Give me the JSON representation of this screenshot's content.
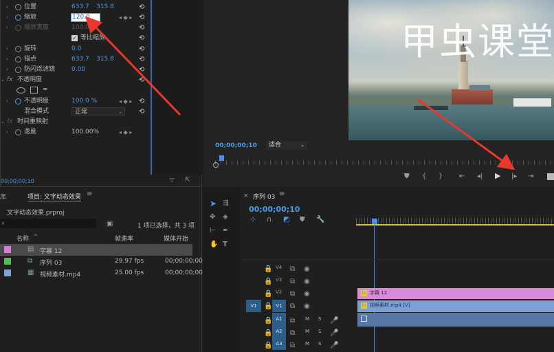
{
  "effect_controls": {
    "rows": [
      {
        "label": "位置",
        "v1": "633.7",
        "v2": "315.8"
      },
      {
        "label": "缩放",
        "v1": "120.0",
        "v2": ""
      },
      {
        "label": "缩放宽度",
        "v1": "100.0",
        "v2": ""
      },
      {
        "label": "等比缩放",
        "v1": "",
        "v2": ""
      },
      {
        "label": "旋转",
        "v1": "0.0",
        "v2": ""
      },
      {
        "label": "锚点",
        "v1": "633.7",
        "v2": "315.8"
      },
      {
        "label": "防闪烁滤镜",
        "v1": "0.00",
        "v2": ""
      },
      {
        "label": "不透明度",
        "v1": "",
        "v2": ""
      },
      {
        "label": "不透明度",
        "v1": "100.0 %",
        "v2": ""
      },
      {
        "label": "混合模式",
        "v1": "正常",
        "v2": ""
      },
      {
        "label": "时间重映射",
        "v1": "",
        "v2": ""
      },
      {
        "label": "速度",
        "v1": "100.00%",
        "v2": ""
      }
    ],
    "fx": "fx",
    "timecode": "00;00;00;10"
  },
  "program_monitor": {
    "overlay_text": "甲虫课堂",
    "timecode": "00;00;00;10",
    "fit_select": "适合",
    "controls": [
      "marker-icon",
      "in-point-icon",
      "out-point-icon",
      "go-to-in-icon",
      "step-back-icon",
      "play-icon",
      "step-forward-icon",
      "go-to-out-icon"
    ]
  },
  "project": {
    "menu_left": "库",
    "tab": "项目: 文字动态效果",
    "file": "文字动态效果.prproj",
    "selection_info": "1 项已选择，共 3 项",
    "col_name": "名称",
    "col_fps": "帧速率",
    "col_start": "媒体开始",
    "items": [
      {
        "name": "字幕 12",
        "fps": "",
        "start": "",
        "color": "#d77bd7"
      },
      {
        "name": "序列 03",
        "fps": "29.97 fps",
        "start": "00;00;00;00",
        "color": "#56b856"
      },
      {
        "name": "视频素材.mp4",
        "fps": "25.00 fps",
        "start": "00;00;00;00",
        "color": "#7ea1d6"
      }
    ]
  },
  "timeline": {
    "title": "序列 03",
    "timecode": "00;00;00;10",
    "tracks": [
      {
        "name": "V4",
        "src": ""
      },
      {
        "name": "V3",
        "src": ""
      },
      {
        "name": "V2",
        "src": ""
      },
      {
        "name": "V1",
        "src": "V1"
      },
      {
        "name": "A1",
        "src": ""
      },
      {
        "name": "A2",
        "src": ""
      },
      {
        "name": "A3",
        "src": ""
      }
    ],
    "clips": [
      {
        "label": "字幕 12",
        "track": "V2",
        "color": "#d88ad8"
      },
      {
        "label": "视频素材.mp4 [V]",
        "track": "V1",
        "color": "#7ca0d4"
      }
    ],
    "audio_flags": {
      "m": "M",
      "s": "S"
    }
  }
}
